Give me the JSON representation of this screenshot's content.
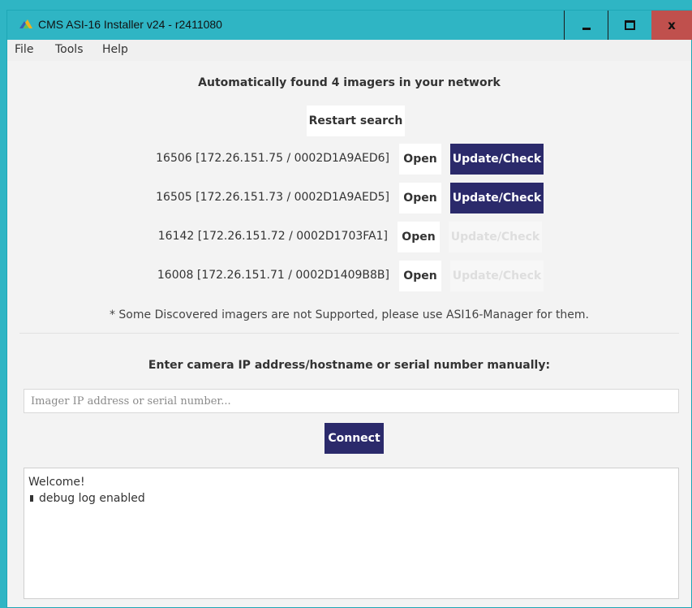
{
  "window": {
    "title": "CMS ASI-16 Installer v24 - r2411080",
    "close_glyph": "x",
    "icons": {
      "app": "app-logo-icon",
      "minimize": "minimize-icon",
      "maximize": "maximize-icon",
      "close": "close-icon"
    }
  },
  "menu": [
    "File",
    "Tools",
    "Help"
  ],
  "discovery": {
    "heading": "Automatically found 4 imagers in your network",
    "restart_label": "Restart search",
    "imagers": [
      {
        "label": "16506 [172.26.151.75 / 0002D1A9AED6]",
        "open_label": "Open",
        "update_label": "Update/Check",
        "update_enabled": true
      },
      {
        "label": "16505 [172.26.151.73 / 0002D1A9AED5]",
        "open_label": "Open",
        "update_label": "Update/Check",
        "update_enabled": true
      },
      {
        "label": "16142 [172.26.151.72 / 0002D1703FA1]",
        "open_label": "Open",
        "update_label": "Update/Check",
        "update_enabled": false
      },
      {
        "label": "16008 [172.26.151.71 / 0002D1409B8B]",
        "open_label": "Open",
        "update_label": "Update/Check",
        "update_enabled": false
      }
    ],
    "note": "* Some Discovered imagers are not Supported, please use ASI16-Manager for them."
  },
  "manual": {
    "heading": "Enter camera IP address/hostname or serial number manually:",
    "placeholder": "Imager IP address or serial number...",
    "value": "",
    "connect_label": "Connect"
  },
  "log": {
    "lines": [
      "Welcome!",
      "debug log enabled"
    ],
    "bullet_icon": "log-entry-bullet-icon"
  },
  "colors": {
    "titlebar": "#2fb5c4",
    "accent": "#2b2a6b",
    "close_button": "#c0504d",
    "disabled_text": "#dedede"
  }
}
